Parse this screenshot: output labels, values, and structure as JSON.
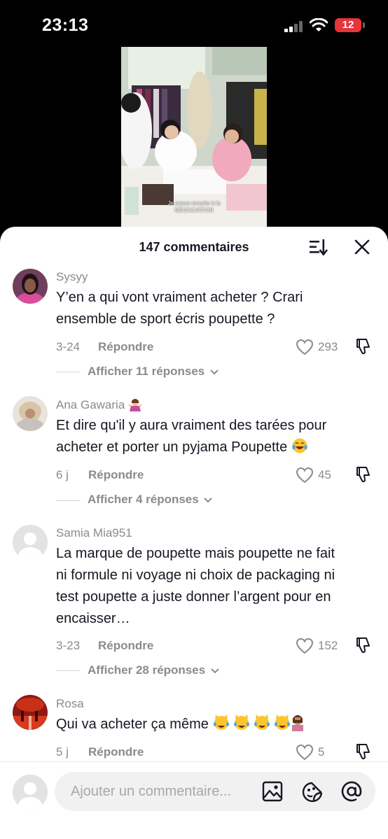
{
  "status": {
    "time": "23:13",
    "battery": "12"
  },
  "video": {
    "caption_line1": "Je passe ensuite à la",
    "caption_line2": "NÉGOCIATION"
  },
  "header": {
    "count_label": "147 commentaires"
  },
  "comments": [
    {
      "user": "Sysyy",
      "text_line1": "Y’en a qui vont vraiment acheter ? Crari",
      "text_line2": "ensemble de sport écris poupette ?",
      "date": "3-24",
      "reply_label": "Répondre",
      "likes": "293",
      "replies_label": "Afficher 11 réponses"
    },
    {
      "user": "Ana Gawaria",
      "text_line1": "Et dire qu'il y aura vraiment des tarées pour",
      "text_line2": "acheter et porter un pyjama Poupette",
      "date": "6 j",
      "reply_label": "Répondre",
      "likes": "45",
      "replies_label": "Afficher 4 réponses"
    },
    {
      "user": "Samia Mia951",
      "text_line1": "La marque de poupette mais poupette ne fait",
      "text_line2": "ni formule ni voyage ni choix de packaging ni",
      "text_line3": "test poupette a juste donner l’argent pour en",
      "text_line4": "encaisser…",
      "date": "3-23",
      "reply_label": "Répondre",
      "likes": "152",
      "replies_label": "Afficher 28 réponses"
    },
    {
      "user": "Rosa",
      "text_line1": "Qui va acheter ça même",
      "date": "5 j",
      "reply_label": "Répondre",
      "likes": "5"
    }
  ],
  "composer": {
    "placeholder": "Ajouter un commentaire..."
  },
  "colors": {
    "text": "#161823",
    "muted": "#8a8b91",
    "battery": "#e5343a"
  },
  "icons": [
    "signal-icon",
    "wifi-icon",
    "sort-icon",
    "close-icon",
    "heart-icon",
    "dislike-icon",
    "image-icon",
    "sticker-icon",
    "mention-icon"
  ]
}
